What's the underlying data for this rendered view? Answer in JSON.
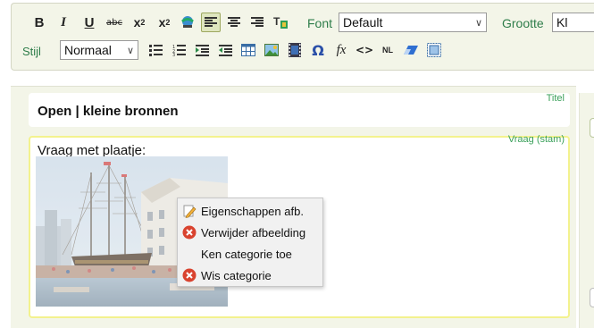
{
  "toolbar": {
    "row1": {
      "bold": "B",
      "italic": "I",
      "underline": "U",
      "strike": "abc",
      "subscript_base": "x",
      "subscript_idx": "2",
      "superscript_base": "x",
      "superscript_idx": "2",
      "font_label": "Font",
      "font_value": "Default",
      "size_label": "Grootte",
      "size_value": "Kl"
    },
    "row2": {
      "style_label": "Stijl",
      "style_value": "Normaal",
      "omega": "Ω",
      "fx": "fx",
      "code": "<>",
      "nl": "NL"
    }
  },
  "title_block": {
    "tag": "Titel",
    "text": "Open | kleine bronnen"
  },
  "stem_block": {
    "tag": "Vraag (stam)",
    "text": "Vraag met plaatje:"
  },
  "context_menu": {
    "items": [
      {
        "label": "Eigenschappen afb.",
        "icon": "pencil-icon"
      },
      {
        "label": "Verwijder afbeelding",
        "icon": "delete-icon"
      },
      {
        "label": "Ken categorie toe",
        "icon": ""
      },
      {
        "label": "Wis categorie",
        "icon": "delete-icon"
      }
    ]
  },
  "colors": {
    "toolbar_bg": "#f3f5e8",
    "label_green": "#2e7d4a",
    "stem_border": "#f3f28e",
    "delete_red": "#d9432f"
  }
}
